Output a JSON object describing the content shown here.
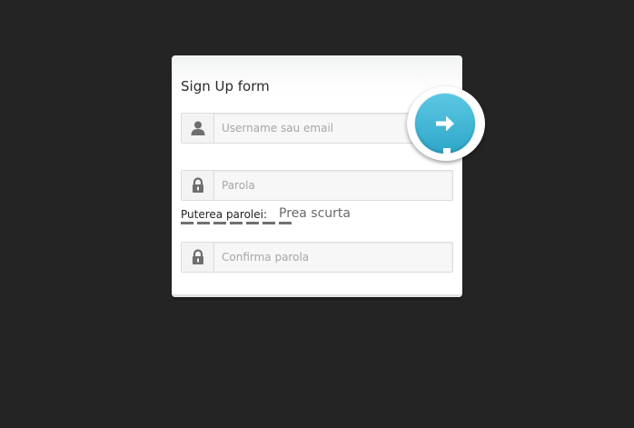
{
  "form": {
    "title": "Sign Up form",
    "username": {
      "placeholder": "Username sau email",
      "value": "",
      "icon": "user-icon"
    },
    "password": {
      "placeholder": "Parola",
      "value": "",
      "icon": "lock-icon"
    },
    "strength": {
      "label": "Puterea parolei:",
      "value": "Prea scurta"
    },
    "confirm": {
      "placeholder": "Confirma parola",
      "value": "",
      "icon": "lock-icon"
    },
    "submit": {
      "icon": "arrow-right-icon"
    }
  },
  "colors": {
    "background": "#242424",
    "card": "#ffffff",
    "accent": "#3bb4d6",
    "strength_bar": "#707070"
  }
}
